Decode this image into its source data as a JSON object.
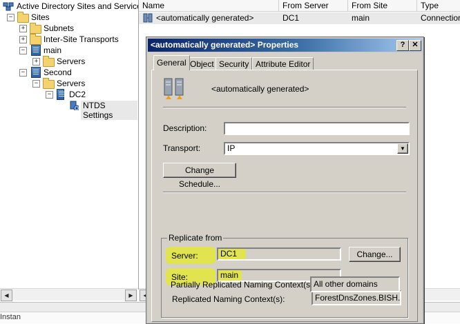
{
  "tree": {
    "root": "Active Directory Sites and Services",
    "items": [
      {
        "label": "Sites"
      },
      {
        "label": "Subnets"
      },
      {
        "label": "Inter-Site Transports"
      },
      {
        "label": "main"
      },
      {
        "label": "Servers"
      },
      {
        "label": "Second"
      },
      {
        "label": "Servers"
      },
      {
        "label": "DC2"
      },
      {
        "label": "NTDS Settings"
      }
    ],
    "partial_text": "Instan"
  },
  "list": {
    "columns": [
      "Name",
      "From Server",
      "From Site",
      "Type"
    ],
    "rows": [
      {
        "name": "<automatically generated>",
        "from_server": "DC1",
        "from_site": "main",
        "type": "Connection"
      }
    ]
  },
  "dialog": {
    "title": "<automatically generated> Properties",
    "help_glyph": "?",
    "close_glyph": "✕",
    "tabs": [
      "General",
      "Object",
      "Security",
      "Attribute Editor"
    ],
    "object_name": "<automatically generated>",
    "description_label": "Description:",
    "description_value": "",
    "transport_label": "Transport:",
    "transport_value": "IP",
    "change_schedule_label": "Change Schedule...",
    "replicate_from_label": "Replicate from",
    "server_label": "Server:",
    "server_value": "DC1",
    "change_button_label": "Change...",
    "site_label": "Site:",
    "site_value": "main",
    "rnc_label": "Replicated Naming Context(s):",
    "rnc_value": "ForestDnsZones.BISH.CO",
    "prnc_label": "Partially Replicated Naming Context(s):",
    "prnc_value": "All other domains",
    "highlight_color": "#e3e63a"
  }
}
